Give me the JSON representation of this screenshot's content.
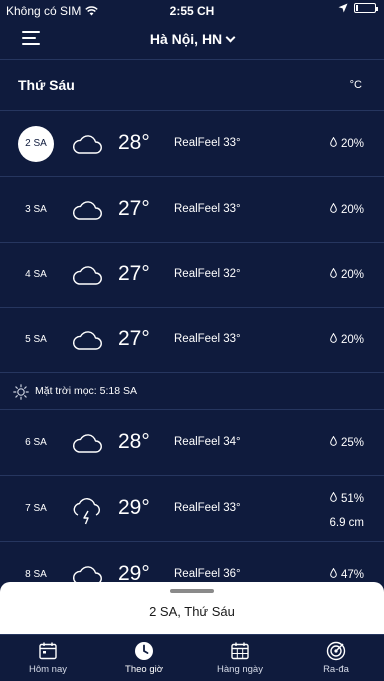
{
  "status_bar": {
    "carrier": "Không có SIM",
    "time": "2:55 CH"
  },
  "header": {
    "location": "Hà Nội, HN"
  },
  "day": {
    "title": "Thứ Sáu",
    "unit": "°C"
  },
  "hours": [
    {
      "hour": "2 SA",
      "icon": "cloud-icon",
      "temp": "28°",
      "realfeel": "RealFeel 33°",
      "precip": "20%"
    },
    {
      "hour": "3 SA",
      "icon": "cloud-icon",
      "temp": "27°",
      "realfeel": "RealFeel 33°",
      "precip": "20%"
    },
    {
      "hour": "4 SA",
      "icon": "cloud-icon",
      "temp": "27°",
      "realfeel": "RealFeel 32°",
      "precip": "20%"
    },
    {
      "hour": "5 SA",
      "icon": "cloud-icon",
      "temp": "27°",
      "realfeel": "RealFeel 33°",
      "precip": "20%"
    },
    {
      "hour": "6 SA",
      "icon": "cloud-icon",
      "temp": "28°",
      "realfeel": "RealFeel 34°",
      "precip": "25%"
    },
    {
      "hour": "7 SA",
      "icon": "thunderstorm-icon",
      "temp": "29°",
      "realfeel": "RealFeel 33°",
      "precip": "51%",
      "amount": "6.9 cm"
    },
    {
      "hour": "8 SA",
      "icon": "cloud-icon",
      "temp": "29°",
      "realfeel": "RealFeel 36°",
      "precip": "47%"
    }
  ],
  "sunrise": {
    "text": "Mặt trời mọc: 5:18 SA"
  },
  "sheet": {
    "title": "2 SA,  Thứ Sáu"
  },
  "tabs": [
    {
      "label": "Hôm nay",
      "icon": "calendar-today-icon"
    },
    {
      "label": "Theo giờ",
      "icon": "clock-icon"
    },
    {
      "label": "Hàng ngày",
      "icon": "calendar-daily-icon"
    },
    {
      "label": "Ra-đa",
      "icon": "radar-icon"
    }
  ],
  "colors": {
    "background": "#0f1b3d",
    "divider": "#26365f",
    "sheet": "#ffffff"
  }
}
